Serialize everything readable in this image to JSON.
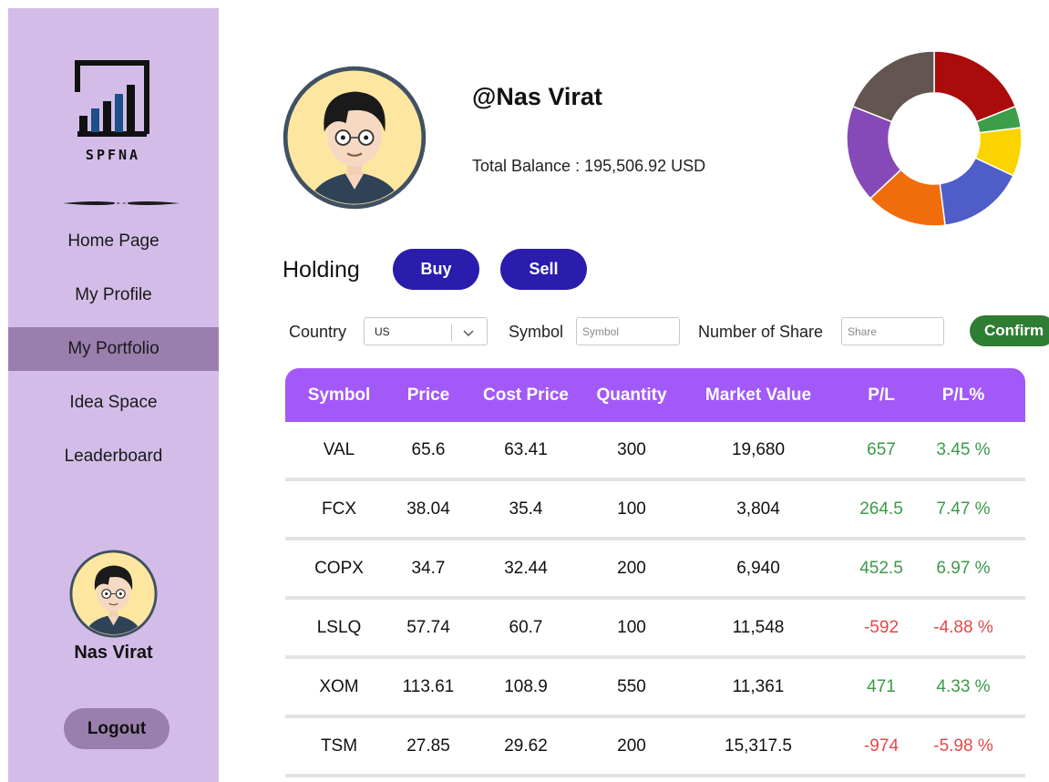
{
  "sidebar": {
    "logo_text": "SPFNA",
    "nav": [
      {
        "label": "Home Page",
        "active": false
      },
      {
        "label": "My Profile",
        "active": false
      },
      {
        "label": "My Portfolio",
        "active": true
      },
      {
        "label": "Idea Space",
        "active": false
      },
      {
        "label": "Leaderboard",
        "active": false
      }
    ],
    "user_name": "Nas Virat",
    "logout_label": "Logout"
  },
  "profile": {
    "username": "@Nas Virat",
    "balance_text": "Total Balance : 195,506.92 USD"
  },
  "allocation_donut": [
    {
      "color": "#aa0b0b",
      "share": 0.19
    },
    {
      "color": "#3d9e4a",
      "share": 0.04
    },
    {
      "color": "#fbd400",
      "share": 0.09
    },
    {
      "color": "#4f5dc9",
      "share": 0.16
    },
    {
      "color": "#f16d0c",
      "share": 0.15
    },
    {
      "color": "#8649b8",
      "share": 0.18
    },
    {
      "color": "#625552",
      "share": 0.19
    }
  ],
  "holding": {
    "title": "Holding",
    "buy_label": "Buy",
    "sell_label": "Sell"
  },
  "filters": {
    "country_label": "Country",
    "country_value": "US",
    "symbol_label": "Symbol",
    "symbol_placeholder": "Symbol",
    "share_label": "Number of Share",
    "share_placeholder": "Share",
    "confirm_label": "Confirm"
  },
  "table": {
    "headers": [
      "Symbol",
      "Price",
      "Cost Price",
      "Quantity",
      "Market Value",
      "P/L",
      "P/L%"
    ],
    "rows": [
      {
        "symbol": "VAL",
        "price": "65.6",
        "cost": "63.41",
        "qty": "300",
        "mv": "19,680",
        "pl": "657",
        "plp": "3.45 %",
        "trend": "pos"
      },
      {
        "symbol": "FCX",
        "price": "38.04",
        "cost": "35.4",
        "qty": "100",
        "mv": "3,804",
        "pl": "264.5",
        "plp": "7.47 %",
        "trend": "pos"
      },
      {
        "symbol": "COPX",
        "price": "34.7",
        "cost": "32.44",
        "qty": "200",
        "mv": "6,940",
        "pl": "452.5",
        "plp": "6.97 %",
        "trend": "pos"
      },
      {
        "symbol": "LSLQ",
        "price": "57.74",
        "cost": "60.7",
        "qty": "100",
        "mv": "11,548",
        "pl": "-592",
        "plp": "-4.88 %",
        "trend": "neg"
      },
      {
        "symbol": "XOM",
        "price": "113.61",
        "cost": "108.9",
        "qty": "550",
        "mv": "11,361",
        "pl": "471",
        "plp": "4.33 %",
        "trend": "pos"
      },
      {
        "symbol": "TSM",
        "price": "27.85",
        "cost": "29.62",
        "qty": "200",
        "mv": "15,317.5",
        "pl": "-974",
        "plp": "-5.98 %",
        "trend": "neg"
      }
    ]
  },
  "icons": {
    "logo": "spfna-logo-icon",
    "avatar": "user-avatar-icon",
    "chevron": "chevron-down-icon"
  }
}
